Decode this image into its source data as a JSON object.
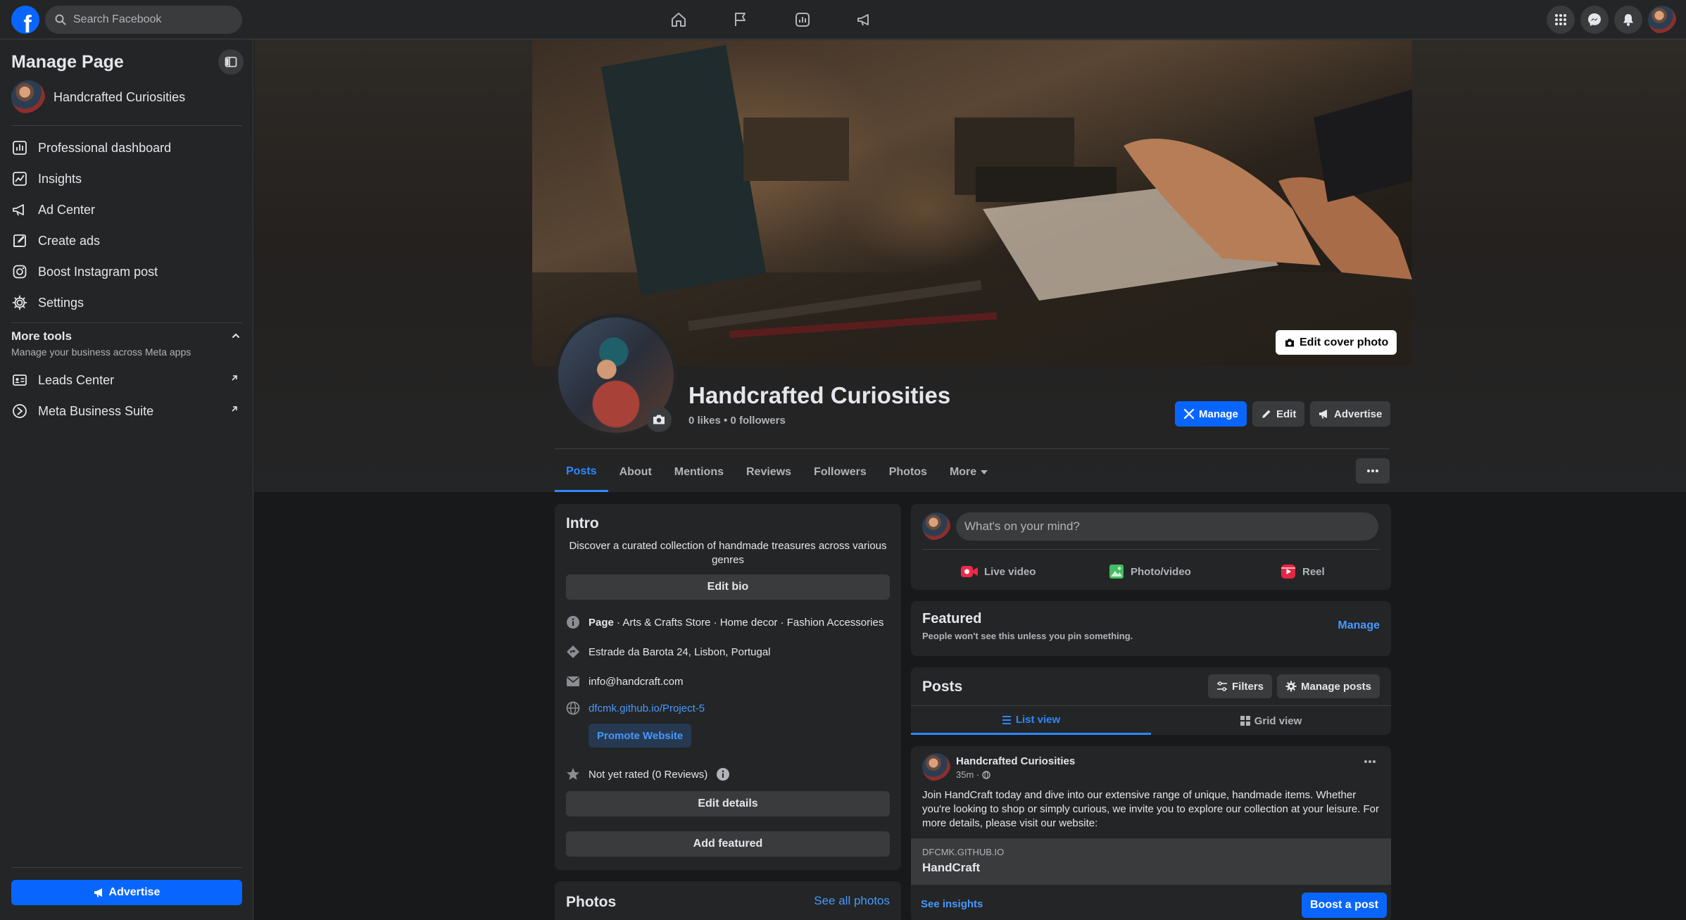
{
  "topbar": {
    "logo": "f",
    "search_placeholder": "Search Facebook",
    "nav_icons": [
      "home-icon",
      "flag-icon",
      "insights-icon",
      "megaphone-icon"
    ],
    "right_icons": [
      "menu-grid-icon",
      "messenger-icon",
      "notifications-icon",
      "account-avatar"
    ]
  },
  "sidebar": {
    "title": "Manage Page",
    "page_name": "Handcrafted Curiosities",
    "items": [
      {
        "label": "Professional dashboard",
        "icon": "dashboard-icon"
      },
      {
        "label": "Insights",
        "icon": "insights-icon"
      },
      {
        "label": "Ad Center",
        "icon": "megaphone-icon"
      },
      {
        "label": "Create ads",
        "icon": "pencil-icon"
      },
      {
        "label": "Boost Instagram post",
        "icon": "instagram-icon"
      },
      {
        "label": "Settings",
        "icon": "gear-icon"
      }
    ],
    "more_tools_title": "More tools",
    "more_tools_subtitle": "Manage your business across Meta apps",
    "tools": [
      {
        "label": "Leads Center",
        "icon": "leads-icon"
      },
      {
        "label": "Meta Business Suite",
        "icon": "business-suite-icon"
      }
    ],
    "advertise_label": "Advertise"
  },
  "header": {
    "edit_cover_label": "Edit cover photo",
    "page_name": "Handcrafted Curiosities",
    "stats": "0 likes • 0 followers",
    "manage_label": "Manage",
    "edit_label": "Edit",
    "advertise_label": "Advertise"
  },
  "tabs": [
    {
      "label": "Posts",
      "active": true
    },
    {
      "label": "About"
    },
    {
      "label": "Mentions"
    },
    {
      "label": "Reviews"
    },
    {
      "label": "Followers"
    },
    {
      "label": "Photos"
    },
    {
      "label": "More"
    }
  ],
  "intro": {
    "title": "Intro",
    "bio": "Discover a curated collection of handmade treasures across various genres",
    "edit_bio_label": "Edit bio",
    "category_prefix": "Page",
    "categories": " · Arts & Crafts Store · Home decor · Fashion Accessories",
    "address": "Estrade da Barota 24, Lisbon, Portugal",
    "email": "info@handcraft.com",
    "website": "dfcmk.github.io/Project-5",
    "promote_label": "Promote Website",
    "rating": "Not yet rated (0 Reviews)",
    "edit_details_label": "Edit details",
    "add_featured_label": "Add featured"
  },
  "photos_card": {
    "title": "Photos",
    "see_all_label": "See all photos"
  },
  "composer": {
    "placeholder": "What's on your mind?",
    "live_label": "Live video",
    "photo_label": "Photo/video",
    "reel_label": "Reel",
    "colors": {
      "live": "#f02849",
      "photo": "#45bd62",
      "reel": "#e42645"
    }
  },
  "featured": {
    "title": "Featured",
    "subtitle": "People won't see this unless you pin something.",
    "manage_label": "Manage"
  },
  "posts_header": {
    "title": "Posts",
    "filters_label": "Filters",
    "manage_posts_label": "Manage posts",
    "list_view_label": "List view",
    "grid_view_label": "Grid view"
  },
  "post": {
    "author": "Handcrafted Curiosities",
    "time": "35m ·",
    "body": "Join HandCraft today and dive into our extensive range of unique, handmade items. Whether you're looking to shop or simply curious, we invite you to explore our collection at your leisure. For more details, please visit our website:",
    "link_domain": "DFCMK.GITHUB.IO",
    "link_title": "HandCraft",
    "insights_label": "See insights",
    "boost_label": "Boost a post"
  }
}
